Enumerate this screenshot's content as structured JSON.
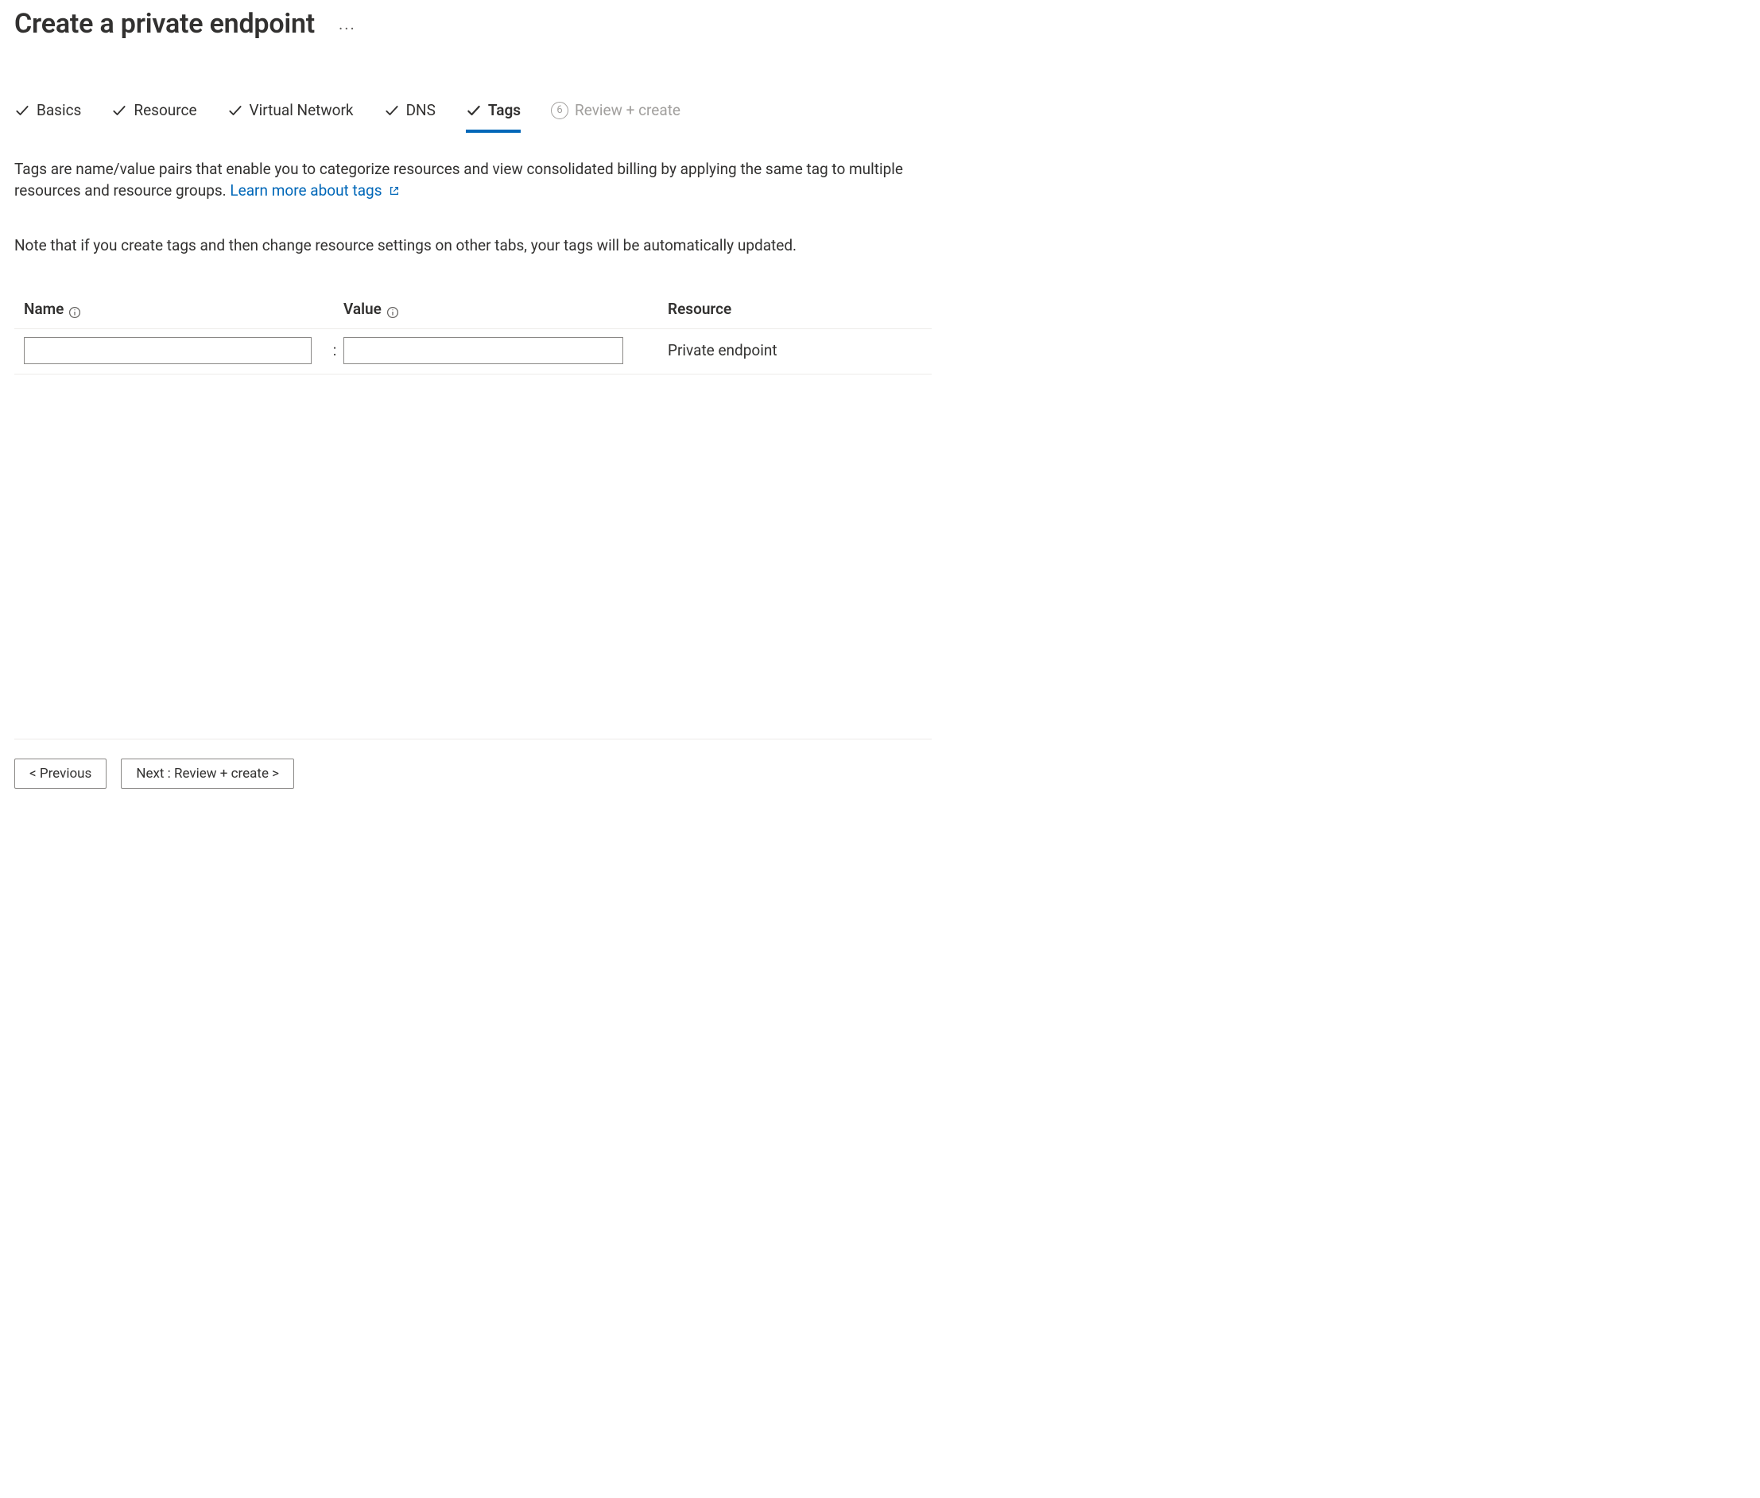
{
  "header": {
    "title": "Create a private endpoint"
  },
  "tabs": {
    "items": [
      {
        "label": "Basics",
        "completed": true
      },
      {
        "label": "Resource",
        "completed": true
      },
      {
        "label": "Virtual Network",
        "completed": true
      },
      {
        "label": "DNS",
        "completed": true
      },
      {
        "label": "Tags",
        "completed": true,
        "active": true
      },
      {
        "label": "Review + create",
        "step": "6",
        "disabled": true
      }
    ]
  },
  "description": {
    "text": "Tags are name/value pairs that enable you to categorize resources and view consolidated billing by applying the same tag to multiple resources and resource groups.",
    "learn_more_label": "Learn more about tags",
    "note": "Note that if you create tags and then change resource settings on other tabs, your tags will be automatically updated."
  },
  "tags_table": {
    "columns": {
      "name": "Name",
      "value": "Value",
      "resource": "Resource"
    },
    "rows": [
      {
        "name": "",
        "value": "",
        "resource": "Private endpoint"
      }
    ],
    "separator": ":"
  },
  "footer": {
    "previous_label": "< Previous",
    "next_label": "Next : Review + create >"
  }
}
